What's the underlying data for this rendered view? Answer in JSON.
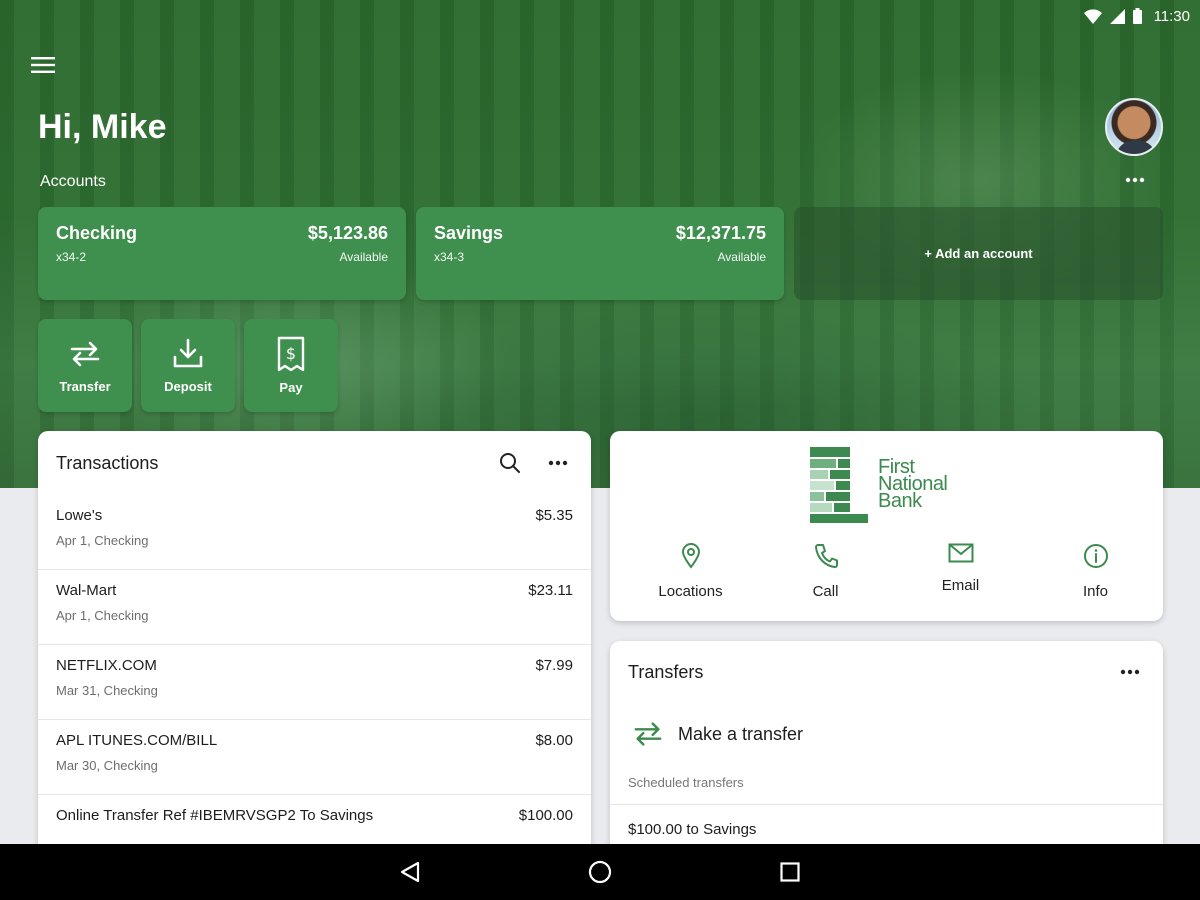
{
  "status_bar": {
    "time": "11:30"
  },
  "greeting": "Hi, Mike",
  "accounts": {
    "label": "Accounts",
    "items": [
      {
        "name": "Checking",
        "number": "x34-2",
        "balance": "$5,123.86",
        "balance_label": "Available"
      },
      {
        "name": "Savings",
        "number": "x34-3",
        "balance": "$12,371.75",
        "balance_label": "Available"
      }
    ],
    "add_label": "+ Add an account"
  },
  "actions": [
    {
      "label": "Transfer",
      "icon": "transfer-icon"
    },
    {
      "label": "Deposit",
      "icon": "deposit-icon"
    },
    {
      "label": "Pay",
      "icon": "bill-icon"
    }
  ],
  "transactions": {
    "title": "Transactions",
    "items": [
      {
        "merchant": "Lowe's",
        "amount": "$5.35",
        "detail": "Apr 1, Checking"
      },
      {
        "merchant": "Wal-Mart",
        "amount": "$23.11",
        "detail": "Apr 1, Checking"
      },
      {
        "merchant": "NETFLIX.COM",
        "amount": "$7.99",
        "detail": "Mar 31, Checking"
      },
      {
        "merchant": "APL ITUNES.COM/BILL",
        "amount": "$8.00",
        "detail": "Mar 30, Checking"
      },
      {
        "merchant": "Online Transfer Ref #IBEMRVSGP2 To Savings",
        "amount": "$100.00",
        "detail": ""
      }
    ]
  },
  "bank": {
    "logo_line1": "First",
    "logo_line2": "National",
    "logo_line3": "Bank",
    "actions": [
      {
        "label": "Locations",
        "icon": "location-pin-icon"
      },
      {
        "label": "Call",
        "icon": "phone-icon"
      },
      {
        "label": "Email",
        "icon": "mail-icon"
      },
      {
        "label": "Info",
        "icon": "info-icon"
      }
    ]
  },
  "transfers": {
    "title": "Transfers",
    "make_label": "Make a transfer",
    "scheduled_label": "Scheduled transfers",
    "scheduled_items": [
      "$100.00 to Savings"
    ]
  },
  "colors": {
    "brand_green": "#2e6e32",
    "card_green": "#3f8f4f",
    "logo_green": "#3c8a4f"
  }
}
